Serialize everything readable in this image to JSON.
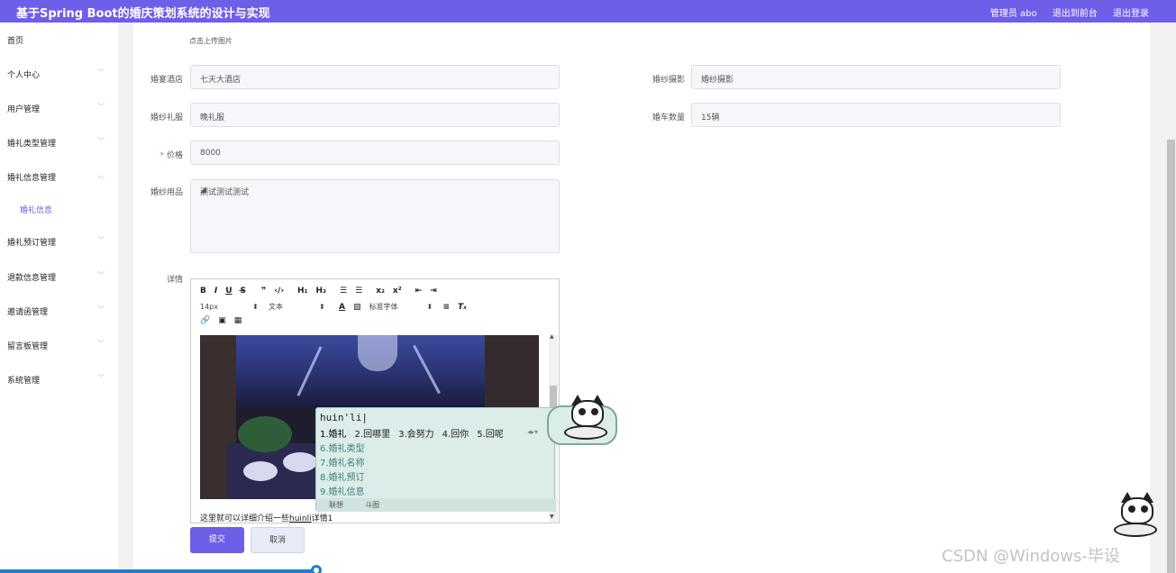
{
  "header": {
    "title": "基于Spring Boot的婚庆策划系统的设计与实现",
    "admin": "管理员 abo",
    "back_front": "退出到前台",
    "logout": "退出登录",
    "accent": "#6d5fe8"
  },
  "sidebar": {
    "items": [
      {
        "label": "首页"
      },
      {
        "label": "个人中心"
      },
      {
        "label": "用户管理"
      },
      {
        "label": "婚礼类型管理"
      },
      {
        "label": "婚礼信息管理"
      },
      {
        "label": "婚礼信息"
      },
      {
        "label": "婚礼预订管理"
      },
      {
        "label": "退款信息管理"
      },
      {
        "label": "邀请函管理"
      },
      {
        "label": "留言板管理"
      },
      {
        "label": "系统管理"
      }
    ]
  },
  "form": {
    "upload_hint": "点击上传图片",
    "hotel_label": "婚宴酒店",
    "hotel_value": "七天大酒店",
    "photo_label": "婚纱摄影",
    "photo_value": "婚纱摄影",
    "dress_label": "婚纱礼服",
    "dress_value": "晚礼服",
    "cars_label": "婚车数量",
    "cars_value": "15辆",
    "price_label": "价格",
    "price_value": "8000",
    "supplies_label": "婚纱用品",
    "supplies_value": "测试测试测试",
    "detail_label": "详情"
  },
  "editor": {
    "font_size": "14px",
    "block_type": "文本",
    "font_family": "标准字体",
    "content_prefix": "这里就可以详细介绍一些",
    "content_underlined": "huinli",
    "content_suffix": "详情1"
  },
  "ime": {
    "composition": "huin'li|",
    "row1": [
      "1.婚礼",
      "2.回哪里",
      "3.会努力",
      "4.回你",
      "5.回呢"
    ],
    "more": [
      "6.婚礼类型",
      "7.婚礼名称",
      "8.婚礼预订",
      "9.婚礼信息"
    ],
    "tabs": [
      "联想",
      "斗图"
    ]
  },
  "buttons": {
    "submit": "提交",
    "cancel": "取消"
  },
  "watermark": "CSDN @Windows-毕设"
}
